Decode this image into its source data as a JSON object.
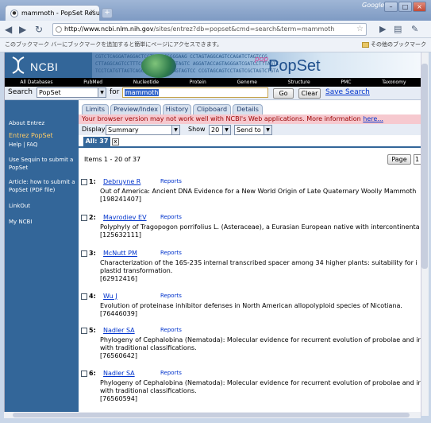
{
  "browser": {
    "tab_title": "mammoth - PopSet Results",
    "tab_close": "×",
    "newtab": "+",
    "google_label": "Google",
    "url_host": "http://www.ncbi.nlm.nih.gov",
    "url_rest": "/sites/entrez?db=popset&cmd=search&term=mammoth",
    "bookmark_hint": "このブックマーク バーにブックマークを追加すると簡単にページにアクセスできます。",
    "other_bookmarks": "その他のブックマーク"
  },
  "ncbi": {
    "logo": "NCBI",
    "popset_logo": "PopSet",
    "popset_prefix": "pop",
    "seq_lines": [
      "CGTCTCAGGATAGGACTCCTTAACCCGGGAAG  CCTAGTAGGCAGTCCAGATCTAGTCCG",
      "CTTAGGCAGTCCTTTCCACCAGGATCTCTAGTC AGGATACCAGTAGGGATCGATCCTTTAGTC",
      "TCCTCATGTTAGTCAGCTAGCAGTCCTAGTAGTCC CCGTAGCAGTCCTAGTCGCTAGTCTGTA"
    ],
    "db_bar": [
      "All Databases",
      "PubMed",
      "Nucleotide",
      "Protein",
      "Genome",
      "Structure",
      "PMC",
      "Taxonomy"
    ]
  },
  "search": {
    "label": "Search",
    "db_value": "PopSet",
    "for_label": "for",
    "term": "mammoth",
    "go": "Go",
    "clear": "Clear",
    "save": "Save Search"
  },
  "sidebar": {
    "about": "About Entrez",
    "entrez_popset": "Entrez PopSet",
    "help": "Help | FAQ",
    "sequin": "Use Sequin to submit a PopSet",
    "article": "Article: how to submit a PopSet (PDF file)",
    "linkout": "LinkOut",
    "myncbi": "My NCBI"
  },
  "tabs": [
    "Limits",
    "Preview/Index",
    "History",
    "Clipboard",
    "Details"
  ],
  "warning": {
    "text": "Your browser version may not work well with NCBI's Web applications. More information",
    "link": "here..."
  },
  "display": {
    "label": "Display",
    "value": "Summary",
    "show_label": "Show",
    "show_value": "20",
    "send_value": "Send to"
  },
  "results_tab": {
    "label": "All: 37",
    "close": "x"
  },
  "paging": {
    "info": "Items 1 - 20 of 37",
    "page_btn": "Page",
    "page_value": "1"
  },
  "results": [
    {
      "num": "1:",
      "author": "Debruyne R",
      "reports": "Reports",
      "title": "Out of America: Ancient DNA Evidence for a New World Origin of Late Quaternary Woolly Mammoth",
      "id": "[198241407]"
    },
    {
      "num": "2:",
      "author": "Mavrodiev EV",
      "reports": "Reports",
      "title": "Polyphyly of Tragopogon porrifolius L. (Asteraceae), a Eurasian European native with intercontinenta",
      "id": "[125632111]"
    },
    {
      "num": "3:",
      "author": "McNutt PM",
      "reports": "Reports",
      "title": "Characterization of the 16S-23S internal transcribed spacer among 34 higher plants: suitability for i plastid transformation.",
      "id": "[62912416]"
    },
    {
      "num": "4:",
      "author": "Wu J",
      "reports": "Reports",
      "title": "Evolution of proteinase inhibitor defenses in North American allopolyploid species of Nicotiana.",
      "id": "[76446039]"
    },
    {
      "num": "5:",
      "author": "Nadler SA",
      "reports": "Reports",
      "title": "Phylogeny of Cephalobina (Nematoda): Molecular evidence for recurrent evolution of probolae and ir with traditional classifications.",
      "id": "[76560642]"
    },
    {
      "num": "6:",
      "author": "Nadler SA",
      "reports": "Reports",
      "title": "Phylogeny of Cephalobina (Nematoda): Molecular evidence for recurrent evolution of probolae and ir with traditional classifications.",
      "id": "[76560594]"
    }
  ]
}
